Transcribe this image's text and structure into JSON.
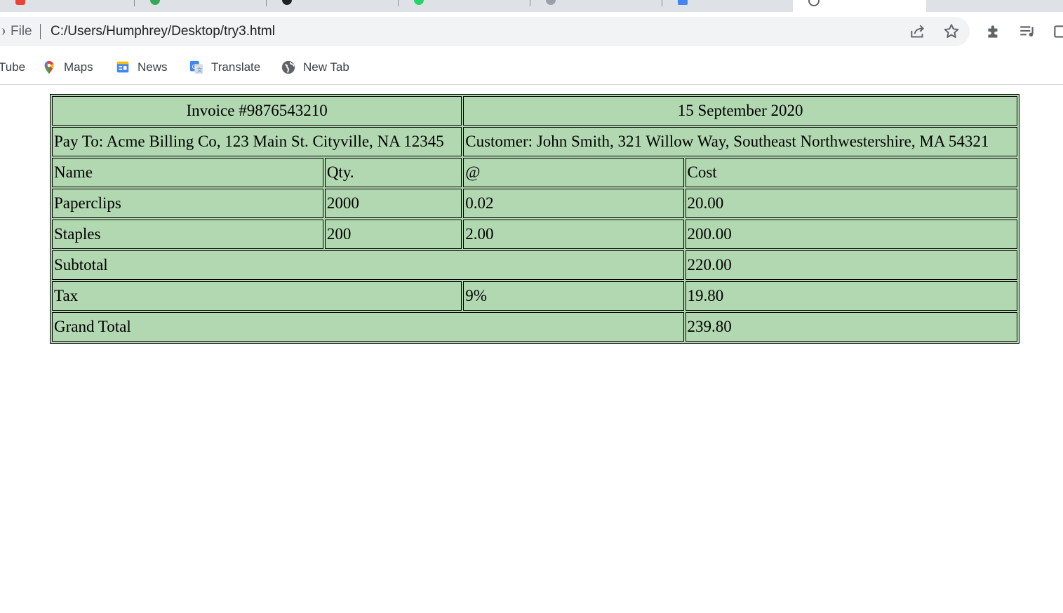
{
  "browser": {
    "tabs": [
      {
        "color": "#ea4335"
      },
      {
        "color": "#34a853"
      },
      {
        "color": "#202124"
      },
      {
        "color": "#25d366"
      },
      {
        "color": "#5f6368"
      },
      {
        "color": "#4285f4"
      },
      {
        "color": "#5f6368",
        "active": true
      }
    ],
    "address": {
      "scheme_label": "File",
      "url": "C:/Users/Humphrey/Desktop/try3.html"
    },
    "icons": [
      "share-icon",
      "star-icon",
      "extensions-icon",
      "reading-list-icon",
      "side-panel-icon"
    ],
    "bookmarks": [
      {
        "label": "Tube",
        "icon": "youtube-icon"
      },
      {
        "label": "Maps",
        "icon": "maps-icon"
      },
      {
        "label": "News",
        "icon": "news-icon"
      },
      {
        "label": "Translate",
        "icon": "translate-icon"
      },
      {
        "label": "New Tab",
        "icon": "globe-icon"
      }
    ]
  },
  "invoice": {
    "number": "Invoice #9876543210",
    "date": "15 September 2020",
    "pay_to": "Pay To: Acme Billing Co, 123 Main St. Cityville, NA 12345",
    "customer": "Customer: John Smith, 321 Willow Way, Southeast Northwestershire, MA 54321",
    "headers": {
      "name": "Name",
      "qty": "Qty.",
      "at": "@",
      "cost": "Cost"
    },
    "items": [
      {
        "name": "Paperclips",
        "qty": "2000",
        "price": "0.02",
        "cost": "20.00"
      },
      {
        "name": "Staples",
        "qty": "200",
        "price": "2.00",
        "cost": "200.00"
      }
    ],
    "subtotal": {
      "label": "Subtotal",
      "value": "220.00"
    },
    "tax": {
      "label": "Tax",
      "rate": "9%",
      "value": "19.80"
    },
    "grand_total": {
      "label": "Grand Total",
      "value": "239.80"
    },
    "background": "#b2d8b1"
  }
}
